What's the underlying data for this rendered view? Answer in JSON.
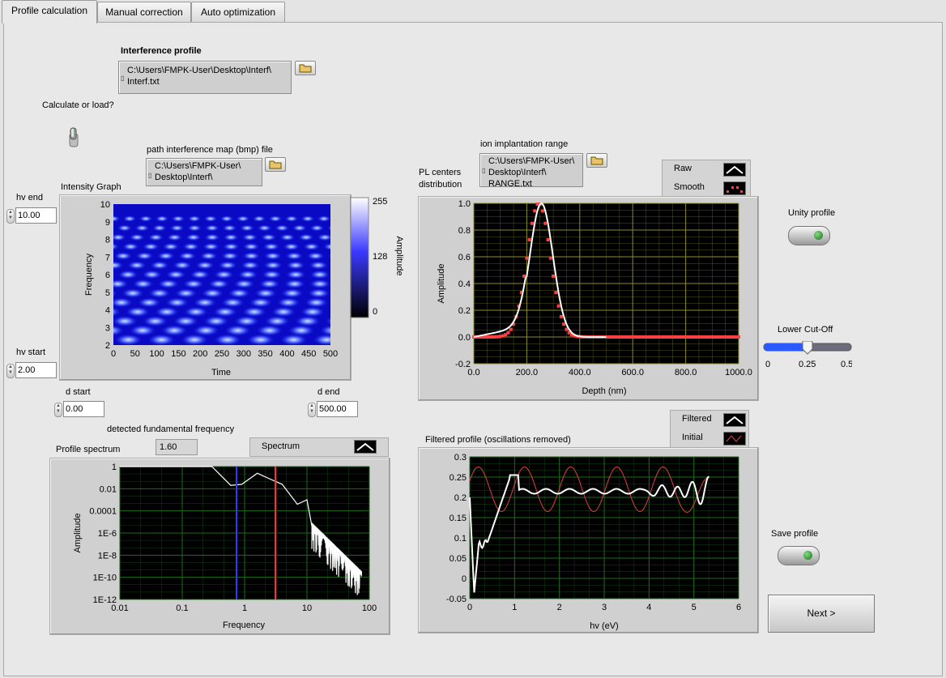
{
  "tabs": [
    "Profile calculation",
    "Manual correction",
    "Auto optimization"
  ],
  "interference": {
    "title": "Interference profile",
    "path_line1": "C:\\Users\\FMPK-User\\Desktop\\Interf\\",
    "path_line2": "Interf.txt"
  },
  "calc_or_load": "Calculate or load?",
  "bmp": {
    "label": "path interference map (bmp) file",
    "path_line1": "C:\\Users\\FMPK-User\\",
    "path_line2": "Desktop\\Interf\\"
  },
  "intensity": {
    "title": "Intensity Graph",
    "ylabel": "Frequency",
    "xlabel": "Time",
    "yticks": [
      "10",
      "9",
      "8",
      "7",
      "6",
      "5",
      "4",
      "3",
      "2"
    ],
    "xticks": [
      "0",
      "50",
      "100",
      "150",
      "200",
      "250",
      "300",
      "350",
      "400",
      "450",
      "500"
    ],
    "colorbar_label": "Amplitude",
    "colorbar_ticks": [
      "255",
      "128",
      "0"
    ]
  },
  "hv_end": {
    "label": "hv end",
    "value": "10.00"
  },
  "hv_start": {
    "label": "hv start",
    "value": "2.00"
  },
  "d_start": {
    "label": "d start",
    "value": "0.00"
  },
  "d_end": {
    "label": "d end",
    "value": "500.00"
  },
  "fundamental": {
    "label": "detected fundamental frequency",
    "value": "1.60"
  },
  "ion": {
    "label": "ion implantation range",
    "path_line1": "C:\\Users\\FMPK-User\\",
    "path_line2": "Desktop\\Interf\\",
    "path_line3": "RANGE.txt"
  },
  "pl": {
    "title_line1": "PL centers",
    "title_line2": "distribution",
    "ylabel": "Amplitude",
    "xlabel": "Depth (nm)",
    "yticks": [
      "1.0",
      "0.8",
      "0.6",
      "0.4",
      "0.2",
      "0.0",
      "-0.2"
    ],
    "xticks": [
      "0.0",
      "200.0",
      "400.0",
      "600.0",
      "800.0",
      "1000.0"
    ],
    "legend": [
      "Raw",
      "Smooth"
    ]
  },
  "unity_profile": "Unity profile",
  "cutoff": {
    "label": "Lower Cut-Off",
    "ticks": [
      "0",
      "0.25",
      "0.5"
    ],
    "value": 0.25
  },
  "spectrum": {
    "title": "Profile spectrum",
    "legend": "Spectrum",
    "ylabel": "Amplitude",
    "xlabel": "Frequency",
    "yticks": [
      "1",
      "0.01",
      "0.0001",
      "1E-6",
      "1E-8",
      "1E-10",
      "1E-12"
    ],
    "xticks": [
      "0.01",
      "0.1",
      "1",
      "10",
      "100"
    ]
  },
  "filtered": {
    "title": "Filtered profile (oscillations removed)",
    "legend": [
      "Filtered",
      "Initial"
    ],
    "xlabel": "hv (eV)",
    "yticks": [
      "0.3",
      "0.25",
      "0.2",
      "0.15",
      "0.1",
      "0.05",
      "0",
      "-0.05"
    ],
    "xticks": [
      "0",
      "1",
      "2",
      "3",
      "4",
      "5",
      "6"
    ]
  },
  "save_profile": "Save profile",
  "next_button": "Next >",
  "colors": {
    "grid_bg": "#000000",
    "pl_grid": "#8a8a2a",
    "spec_grid": "#1f6a1f",
    "raw": "#ffffff",
    "smooth": "#ff4040",
    "initial": "#e04040",
    "cutoff_line": "#ff3030",
    "marker_line": "#2a3aff"
  }
}
